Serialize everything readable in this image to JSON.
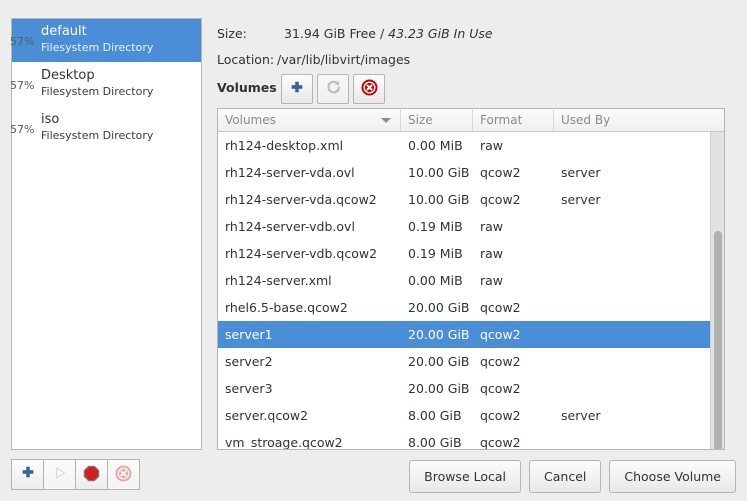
{
  "pools": {
    "items": [
      {
        "percent": "57%",
        "name": "default",
        "type": "Filesystem Directory",
        "selected": true
      },
      {
        "percent": "57%",
        "name": "Desktop",
        "type": "Filesystem Directory",
        "selected": false
      },
      {
        "percent": "57%",
        "name": "iso",
        "type": "Filesystem Directory",
        "selected": false
      }
    ],
    "actions": [
      {
        "name": "add-pool-button",
        "icon": "plus-icon",
        "enabled": true
      },
      {
        "name": "start-pool-button",
        "icon": "play-icon",
        "enabled": false
      },
      {
        "name": "stop-pool-button",
        "icon": "stop-icon",
        "enabled": true
      },
      {
        "name": "delete-pool-button",
        "icon": "delete-icon",
        "enabled": false
      }
    ]
  },
  "details": {
    "size_label": "Size:",
    "size_value_free": "31.94 GiB Free /",
    "size_value_inuse": "43.23 GiB In Use",
    "location_label": "Location:",
    "location_value": "/var/lib/libvirt/images"
  },
  "volumes": {
    "title": "Volumes",
    "toolbar": [
      {
        "name": "new-volume-button",
        "icon": "plus-icon",
        "enabled": true
      },
      {
        "name": "refresh-volumes-button",
        "icon": "refresh-icon",
        "enabled": false
      },
      {
        "name": "delete-volume-button",
        "icon": "delete-icon",
        "enabled": true
      }
    ],
    "columns": [
      "Volumes",
      "Size",
      "Format",
      "Used By"
    ],
    "sorted_column": "Volumes",
    "rows": [
      {
        "name": "rh124-desktop.xml",
        "size": "0.00 MiB",
        "format": "raw",
        "used_by": "",
        "selected": false
      },
      {
        "name": "rh124-server-vda.ovl",
        "size": "10.00 GiB",
        "format": "qcow2",
        "used_by": "server",
        "selected": false
      },
      {
        "name": "rh124-server-vda.qcow2",
        "size": "10.00 GiB",
        "format": "qcow2",
        "used_by": "server",
        "selected": false
      },
      {
        "name": "rh124-server-vdb.ovl",
        "size": "0.19 MiB",
        "format": "raw",
        "used_by": "",
        "selected": false
      },
      {
        "name": "rh124-server-vdb.qcow2",
        "size": "0.19 MiB",
        "format": "raw",
        "used_by": "",
        "selected": false
      },
      {
        "name": "rh124-server.xml",
        "size": "0.00 MiB",
        "format": "raw",
        "used_by": "",
        "selected": false
      },
      {
        "name": "rhel6.5-base.qcow2",
        "size": "20.00 GiB",
        "format": "qcow2",
        "used_by": "",
        "selected": false
      },
      {
        "name": "server1",
        "size": "20.00 GiB",
        "format": "qcow2",
        "used_by": "",
        "selected": true
      },
      {
        "name": "server2",
        "size": "20.00 GiB",
        "format": "qcow2",
        "used_by": "",
        "selected": false
      },
      {
        "name": "server3",
        "size": "20.00 GiB",
        "format": "qcow2",
        "used_by": "",
        "selected": false
      },
      {
        "name": "server.qcow2",
        "size": "8.00 GiB",
        "format": "qcow2",
        "used_by": "server",
        "selected": false
      },
      {
        "name": "vm_stroage.qcow2",
        "size": "8.00 GiB",
        "format": "qcow2",
        "used_by": "",
        "selected": false
      }
    ]
  },
  "dialog_buttons": [
    {
      "name": "browse-local-button",
      "label": "Browse Local"
    },
    {
      "name": "cancel-button",
      "label": "Cancel"
    },
    {
      "name": "choose-volume-button",
      "label": "Choose Volume"
    }
  ],
  "colors": {
    "selection": "#4a8ed8",
    "accent_plus": "#3465a4",
    "danger": "#cc0000",
    "background": "#ededed"
  }
}
